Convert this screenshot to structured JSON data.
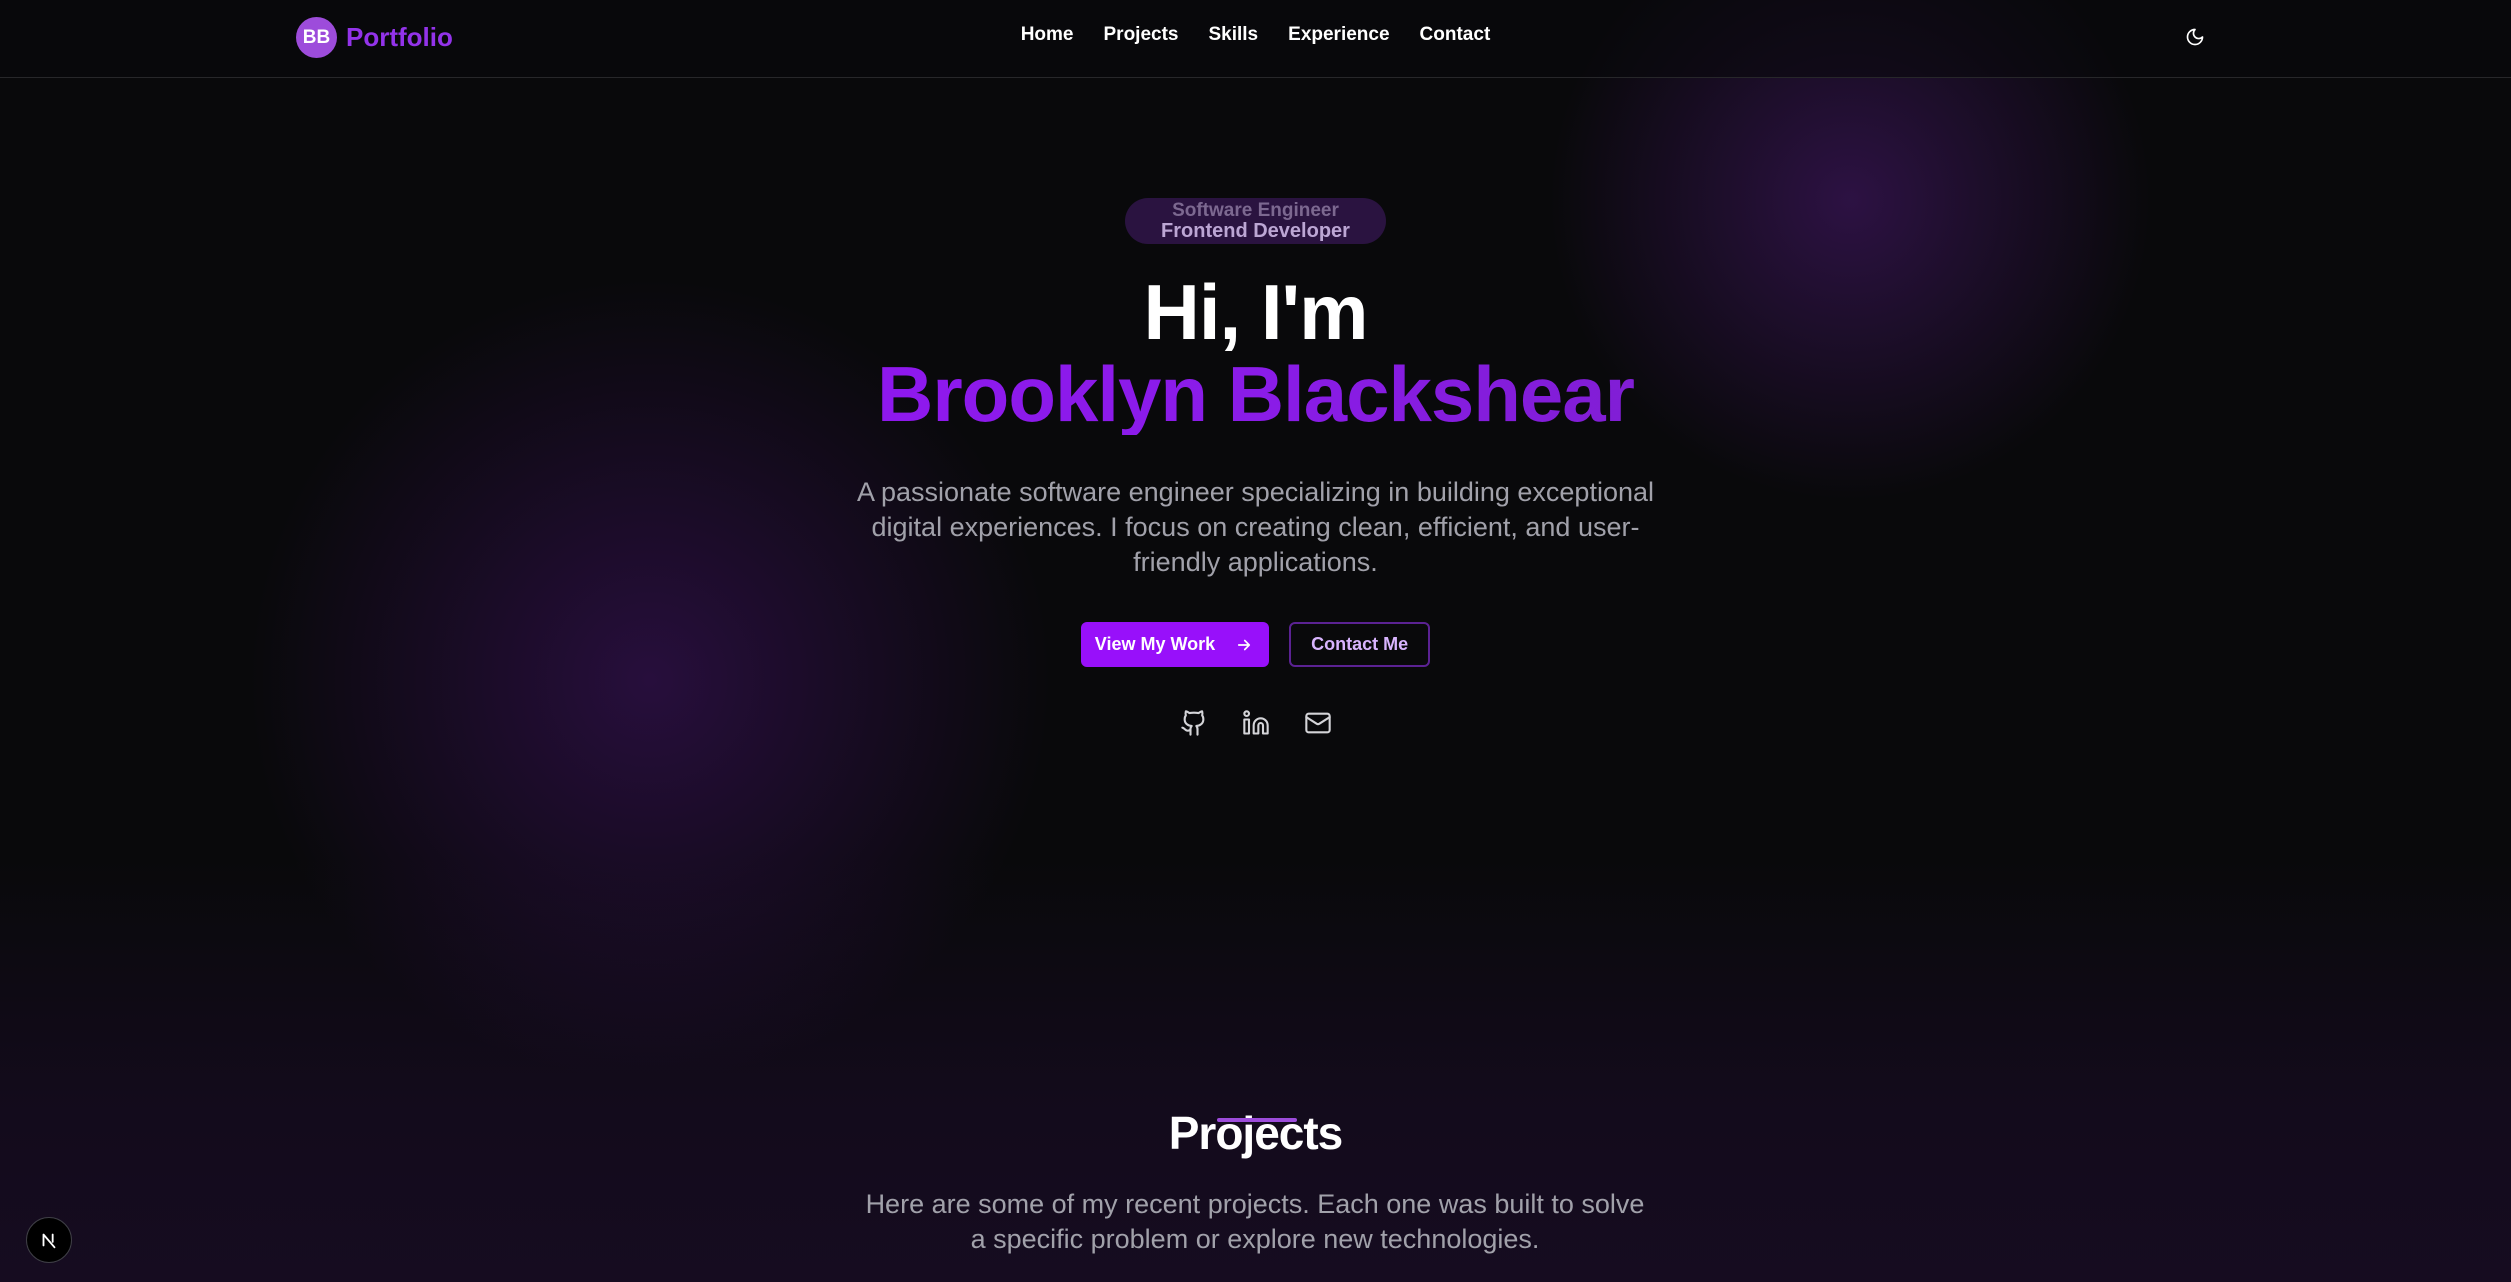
{
  "brand": {
    "initials": "BB",
    "name": "Portfolio"
  },
  "nav": {
    "items": [
      "Home",
      "Projects",
      "Skills",
      "Experience",
      "Contact"
    ]
  },
  "theme_toggle": {
    "icon": "moon-icon"
  },
  "hero": {
    "roles": [
      "Software Engineer",
      "Frontend Developer"
    ],
    "greeting": "Hi, I'm",
    "name": "Brooklyn Blackshear",
    "intro": "A passionate software engineer specializing in building exceptional digital experiences. I focus on creating clean, efficient, and user-friendly applications.",
    "primary_cta": "View My Work",
    "secondary_cta": "Contact Me",
    "socials": [
      "github-icon",
      "linkedin-icon",
      "mail-icon"
    ]
  },
  "projects": {
    "title": "Projects",
    "description": "Here are some of my recent projects. Each one was built to solve a specific problem or explore new technologies."
  },
  "colors": {
    "accent": "#9810fa",
    "background": "#09090b",
    "muted_text": "#a1a1aa"
  }
}
